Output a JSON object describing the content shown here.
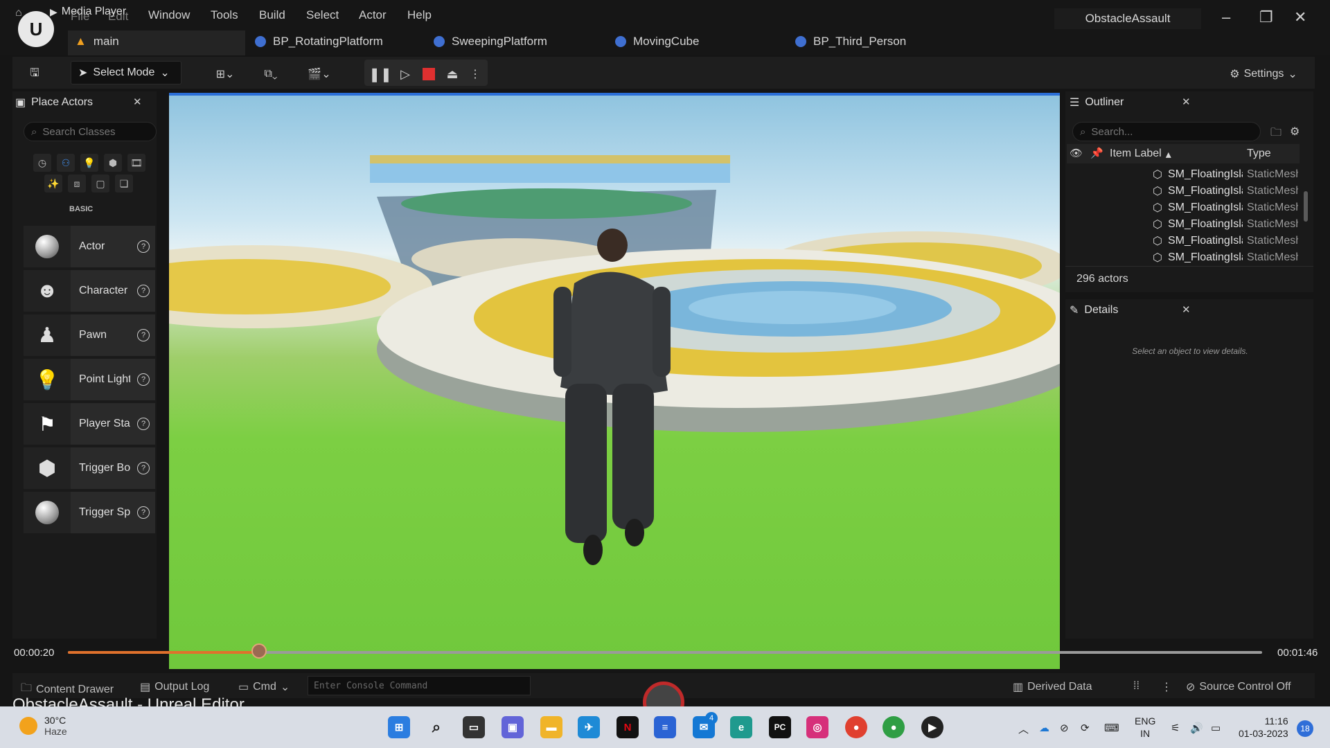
{
  "menu": {
    "media_player": "Media Player",
    "items": [
      "File",
      "Edit",
      "Window",
      "Tools",
      "Build",
      "Select",
      "Actor",
      "Help"
    ]
  },
  "tabs": [
    {
      "label": "main"
    },
    {
      "label": "BP_RotatingPlatform"
    },
    {
      "label": "SweepingPlatform"
    },
    {
      "label": "MovingCube"
    },
    {
      "label": "BP_Third_Person"
    }
  ],
  "project_name": "ObstacleAssault",
  "toolbar": {
    "select_mode": "Select Mode",
    "settings": "Settings"
  },
  "place_actors": {
    "title": "Place Actors",
    "search_placeholder": "Search Classes",
    "category": "BASIC",
    "items": [
      {
        "name": "Actor"
      },
      {
        "name": "Character"
      },
      {
        "name": "Pawn"
      },
      {
        "name": "Point Light"
      },
      {
        "name": "Player Start"
      },
      {
        "name": "Trigger Box"
      },
      {
        "name": "Trigger Sphere"
      }
    ]
  },
  "outliner": {
    "title": "Outliner",
    "search_placeholder": "Search...",
    "col_label": "Item Label",
    "col_type": "Type",
    "rows": [
      {
        "label": "SM_FloatingIsland",
        "type": "StaticMeshActor"
      },
      {
        "label": "SM_FloatingIsland",
        "type": "StaticMeshActor"
      },
      {
        "label": "SM_FloatingIsland",
        "type": "StaticMeshActor"
      },
      {
        "label": "SM_FloatingIsland",
        "type": "StaticMeshActor"
      },
      {
        "label": "SM_FloatingIsland",
        "type": "StaticMeshActor"
      },
      {
        "label": "SM_FloatingIsland",
        "type": "StaticMeshActor"
      }
    ],
    "actor_count": "296 actors"
  },
  "details": {
    "title": "Details",
    "empty_message": "Select an object to view details."
  },
  "media": {
    "current_time": "00:00:20",
    "total_time": "00:01:46",
    "progress": 0.16
  },
  "statusbar": {
    "content_drawer": "Content Drawer",
    "output_log": "Output Log",
    "cmd": "Cmd",
    "console_placeholder": "Enter Console Command",
    "derived_data": "Derived Data",
    "source_control": "Source Control Off"
  },
  "app_title": "ObstacleAssault - Unreal Editor",
  "taskbar": {
    "weather_temp": "30°C",
    "weather_desc": "Haze",
    "lang_line1": "ENG",
    "lang_line2": "IN",
    "time": "11:16",
    "date": "01-03-2023",
    "notifications": "18",
    "mail_badge": "4"
  }
}
